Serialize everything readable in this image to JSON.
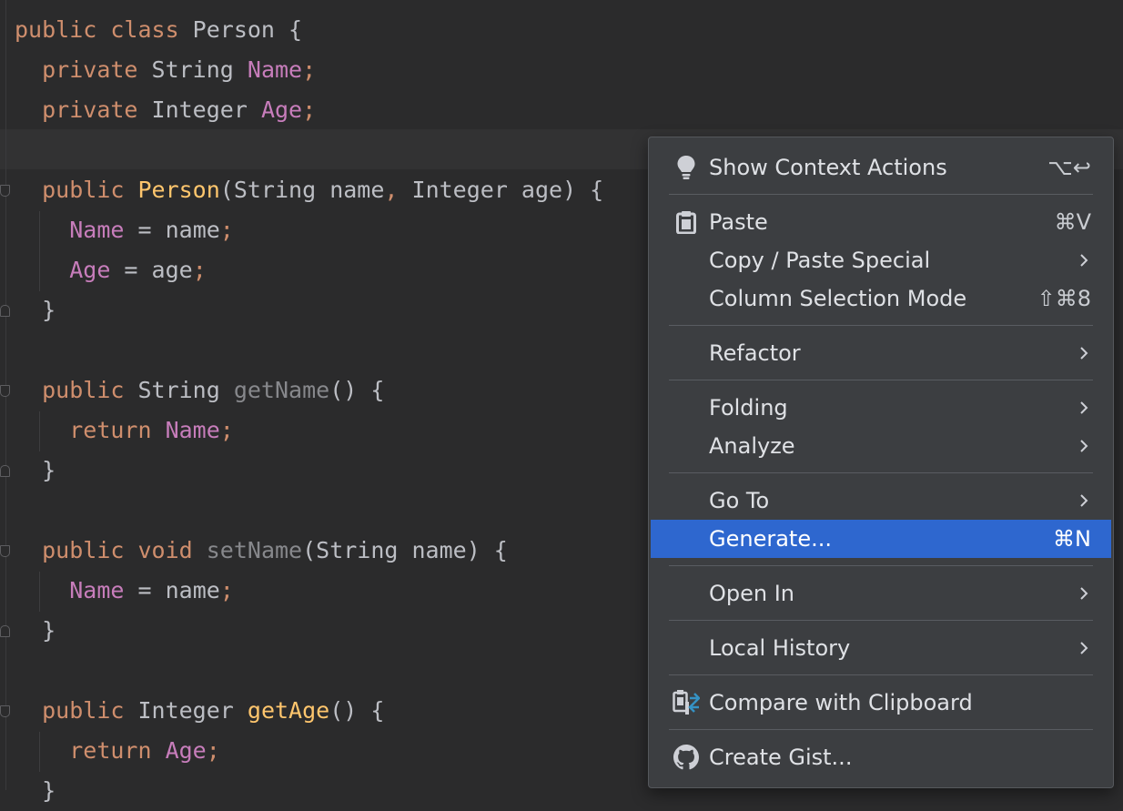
{
  "code": {
    "lines": [
      [
        {
          "t": "public ",
          "c": "kw"
        },
        {
          "t": "class ",
          "c": "kw"
        },
        {
          "t": "Person {",
          "c": ""
        }
      ],
      [
        {
          "t": "  ",
          "c": ""
        },
        {
          "t": "private ",
          "c": "kw"
        },
        {
          "t": "String ",
          "c": ""
        },
        {
          "t": "Name",
          "c": "fld"
        },
        {
          "t": ";",
          "c": "kw"
        }
      ],
      [
        {
          "t": "  ",
          "c": ""
        },
        {
          "t": "private ",
          "c": "kw"
        },
        {
          "t": "Integer ",
          "c": ""
        },
        {
          "t": "Age",
          "c": "fld"
        },
        {
          "t": ";",
          "c": "kw"
        }
      ],
      [],
      [
        {
          "t": "  ",
          "c": ""
        },
        {
          "t": "public ",
          "c": "kw"
        },
        {
          "t": "Person",
          "c": "fn"
        },
        {
          "t": "(String name",
          "c": ""
        },
        {
          "t": ", ",
          "c": "kw"
        },
        {
          "t": "Integer age) {",
          "c": ""
        }
      ],
      [
        {
          "t": "    ",
          "c": ""
        },
        {
          "t": "Name",
          "c": "fld"
        },
        {
          "t": " = name",
          "c": ""
        },
        {
          "t": ";",
          "c": "kw"
        }
      ],
      [
        {
          "t": "    ",
          "c": ""
        },
        {
          "t": "Age",
          "c": "fld"
        },
        {
          "t": " = age",
          "c": ""
        },
        {
          "t": ";",
          "c": "kw"
        }
      ],
      [
        {
          "t": "  }",
          "c": ""
        }
      ],
      [],
      [
        {
          "t": "  ",
          "c": ""
        },
        {
          "t": "public ",
          "c": "kw"
        },
        {
          "t": "String ",
          "c": ""
        },
        {
          "t": "getName",
          "c": "unused"
        },
        {
          "t": "() {",
          "c": ""
        }
      ],
      [
        {
          "t": "    ",
          "c": ""
        },
        {
          "t": "return ",
          "c": "kw"
        },
        {
          "t": "Name",
          "c": "fld"
        },
        {
          "t": ";",
          "c": "kw"
        }
      ],
      [
        {
          "t": "  }",
          "c": ""
        }
      ],
      [],
      [
        {
          "t": "  ",
          "c": ""
        },
        {
          "t": "public ",
          "c": "kw"
        },
        {
          "t": "void ",
          "c": "kw"
        },
        {
          "t": "setName",
          "c": "unused"
        },
        {
          "t": "(String name) {",
          "c": ""
        }
      ],
      [
        {
          "t": "    ",
          "c": ""
        },
        {
          "t": "Name",
          "c": "fld"
        },
        {
          "t": " = name",
          "c": ""
        },
        {
          "t": ";",
          "c": "kw"
        }
      ],
      [
        {
          "t": "  }",
          "c": ""
        }
      ],
      [],
      [
        {
          "t": "  ",
          "c": ""
        },
        {
          "t": "public ",
          "c": "kw"
        },
        {
          "t": "Integer ",
          "c": ""
        },
        {
          "t": "getAge",
          "c": "fn"
        },
        {
          "t": "() {",
          "c": ""
        }
      ],
      [
        {
          "t": "    ",
          "c": ""
        },
        {
          "t": "return ",
          "c": "kw"
        },
        {
          "t": "Age",
          "c": "fld"
        },
        {
          "t": ";",
          "c": "kw"
        }
      ],
      [
        {
          "t": "  }",
          "c": ""
        }
      ]
    ]
  },
  "context_menu": {
    "show_context_actions": {
      "label": "Show Context Actions",
      "shortcut": "⌥↩",
      "icon": "lightbulb-icon"
    },
    "paste": {
      "label": "Paste",
      "shortcut": "⌘V",
      "icon": "clipboard-icon"
    },
    "copy_paste_special": {
      "label": "Copy / Paste Special"
    },
    "column_selection_mode": {
      "label": "Column Selection Mode",
      "shortcut": "⇧⌘8"
    },
    "refactor": {
      "label": "Refactor"
    },
    "folding": {
      "label": "Folding"
    },
    "analyze": {
      "label": "Analyze"
    },
    "go_to": {
      "label": "Go To"
    },
    "generate": {
      "label": "Generate...",
      "shortcut": "⌘N",
      "selected": true
    },
    "open_in": {
      "label": "Open In"
    },
    "local_history": {
      "label": "Local History"
    },
    "compare_with_clipboard": {
      "label": "Compare with Clipboard",
      "icon": "compare-clipboard-icon"
    },
    "create_gist": {
      "label": "Create Gist...",
      "icon": "github-icon"
    }
  },
  "colors": {
    "editor_bg": "#2b2b2c",
    "keyword": "#cf8e6d",
    "field": "#c77dbb",
    "method_decl": "#ffc66d",
    "unused_method": "#87888c",
    "menu_bg": "#3c3e41",
    "menu_selection": "#2e67cf"
  }
}
